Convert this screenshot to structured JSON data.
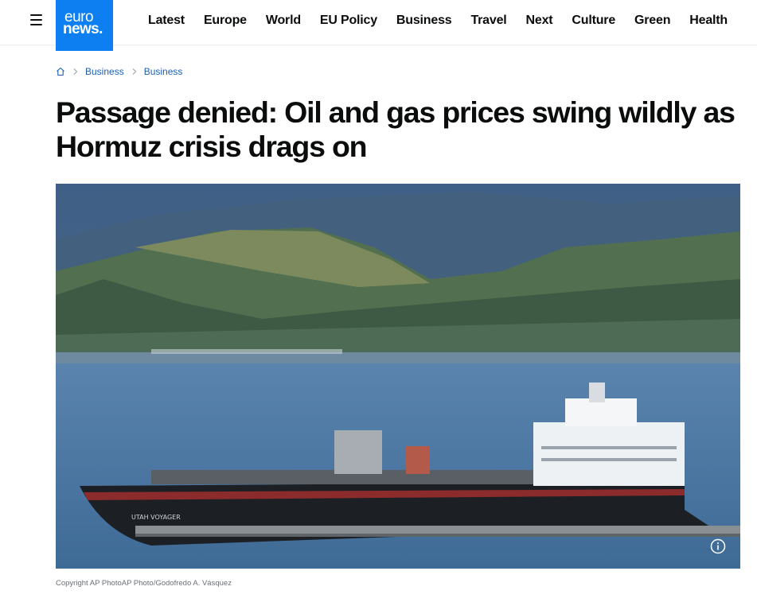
{
  "header": {
    "logo_top": "euro",
    "logo_bottom": "news.",
    "nav": [
      "Latest",
      "Europe",
      "World",
      "EU Policy",
      "Business",
      "Travel",
      "Next",
      "Culture",
      "Green",
      "Health"
    ]
  },
  "breadcrumb": {
    "items": [
      "Business",
      "Business"
    ]
  },
  "article": {
    "title": "Passage denied: Oil and gas prices swing wildly as Hormuz crisis drags on",
    "image_ship_name": "UTAH VOYAGER",
    "caption": "Copyright AP PhotoAP Photo/Godofredo A. Vásquez"
  },
  "colors": {
    "brand": "#0d7ff0",
    "link": "#1a5fb4"
  },
  "icons": [
    "menu-icon",
    "home-icon",
    "chevron-right-icon",
    "info-icon"
  ]
}
